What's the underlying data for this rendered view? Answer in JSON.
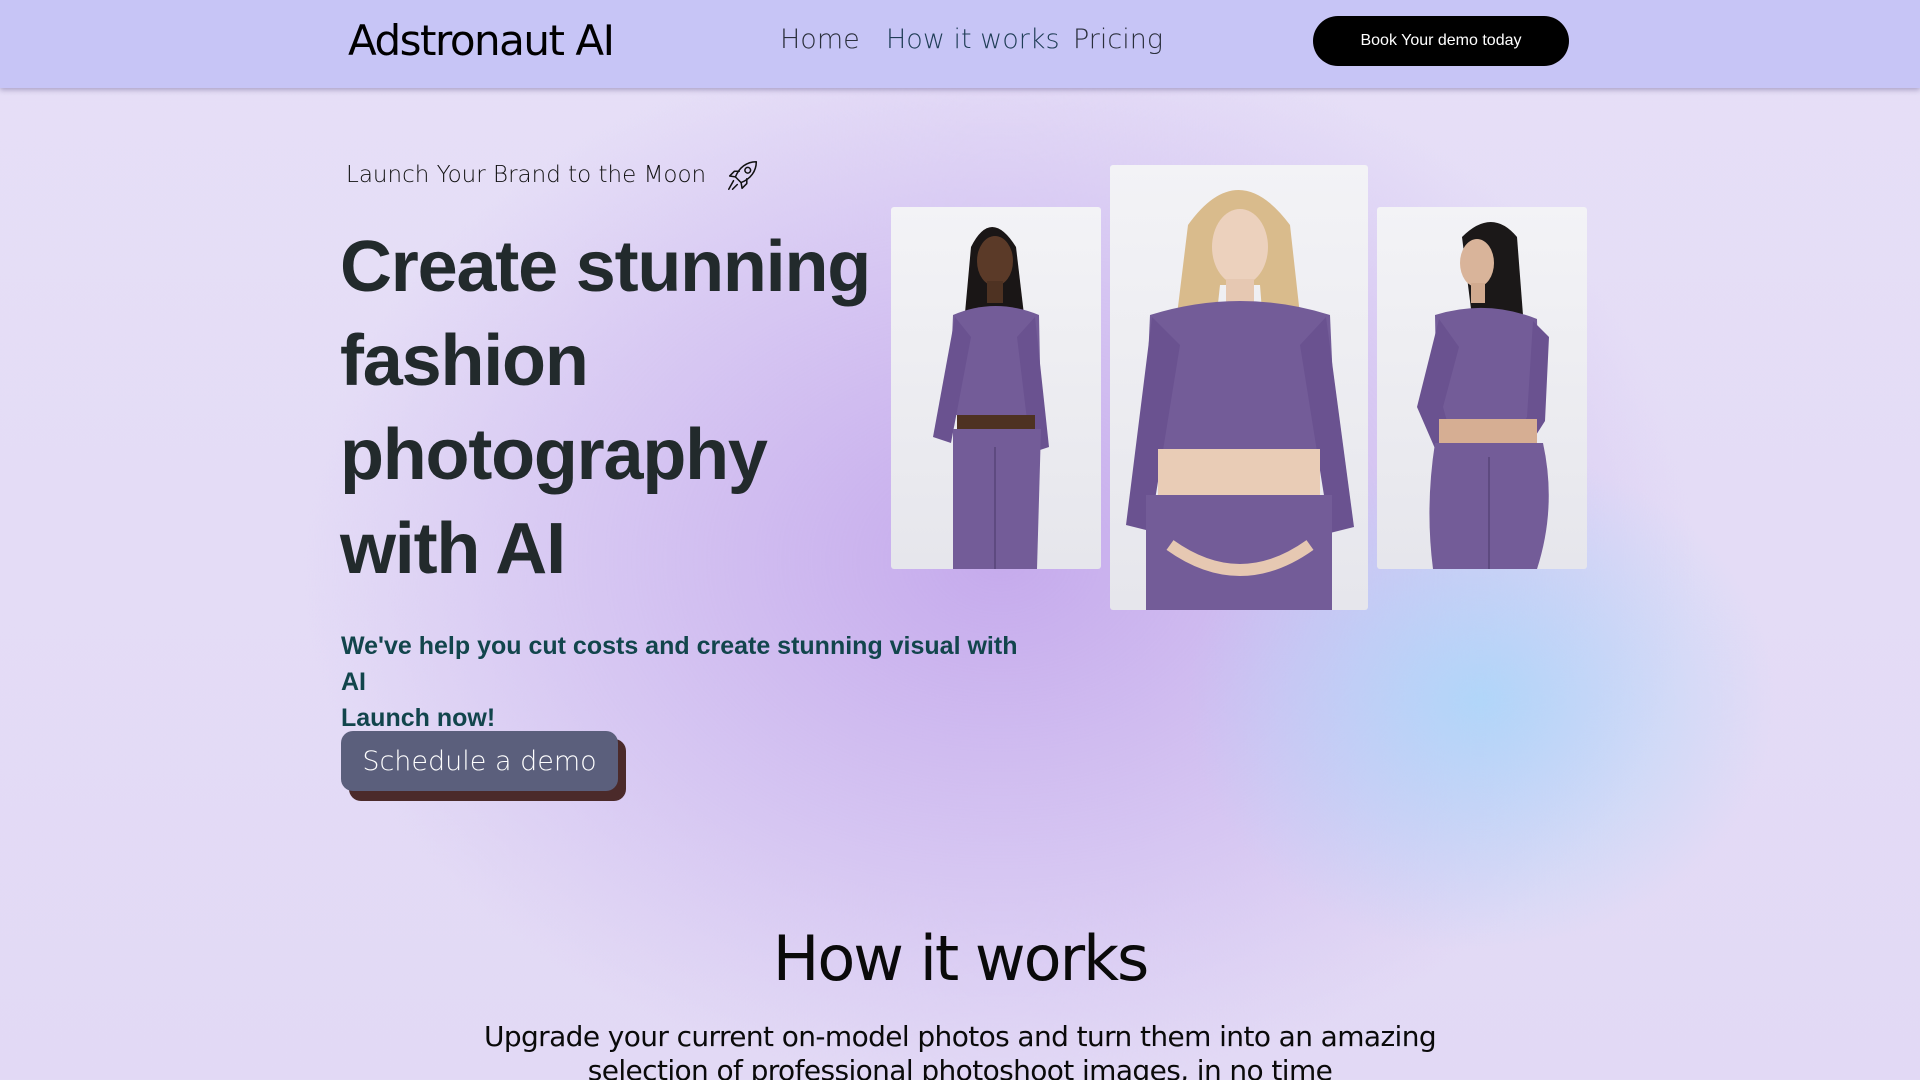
{
  "header": {
    "brand": "Adstronaut AI",
    "nav": [
      {
        "label": "Home"
      },
      {
        "label": "How it works"
      },
      {
        "label": "Pricing"
      }
    ],
    "cta_label": "Book Your demo today"
  },
  "hero": {
    "tagline": "Launch Your Brand to the Moon",
    "tagline_icon": "rocket-icon",
    "headline": "Create stunning fashion photography with AI",
    "subtext_line1": "We've help you cut costs and create stunning visual with AI",
    "subtext_line2": "Launch now!",
    "button_label": "Schedule a demo",
    "gallery": [
      {
        "description": "model-front-dark-hair"
      },
      {
        "description": "model-front-blonde"
      },
      {
        "description": "model-back-dark-hair"
      }
    ]
  },
  "how_it_works": {
    "title": "How it works",
    "subtitle": "Upgrade your current on-model photos and turn them into an amazing selection of professional photoshoot images, in no time"
  },
  "colors": {
    "navbar": "#c7c5f6",
    "cta_button": "#000000",
    "demo_button": "#5b5f7c",
    "headline": "#222a2c",
    "subtext": "#12454c",
    "outfit": "#735c98"
  }
}
